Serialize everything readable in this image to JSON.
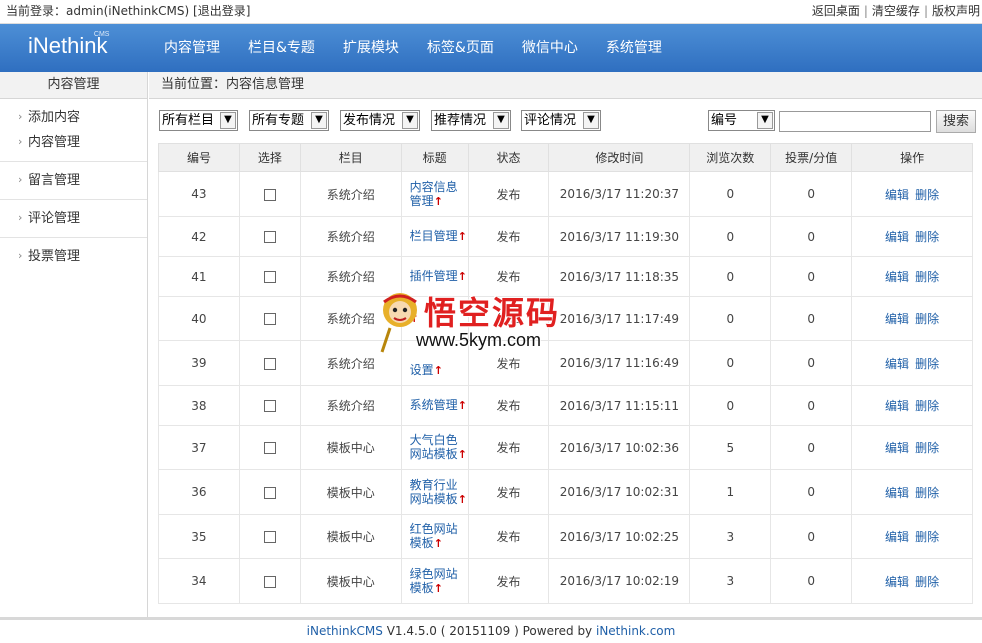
{
  "topbar": {
    "login_text": "当前登录：admin(iNethinkCMS)  [退出登录]",
    "links": [
      "返回桌面",
      "清空缓存",
      "版权声明"
    ]
  },
  "brand": {
    "name": "iNethink",
    "badge": "CMS"
  },
  "nav": [
    "内容管理",
    "栏目&专题",
    "扩展模块",
    "标签&页面",
    "微信中心",
    "系统管理"
  ],
  "sidebar": {
    "title": "内容管理",
    "groups": [
      [
        "添加内容",
        "内容管理"
      ],
      [
        "留言管理"
      ],
      [
        "评论管理"
      ],
      [
        "投票管理"
      ]
    ]
  },
  "breadcrumb": "当前位置：内容信息管理",
  "filters": {
    "selects": [
      "所有栏目",
      "所有专题",
      "发布情况",
      "推荐情况",
      "评论情况"
    ],
    "search_field": "编号",
    "search_button": "搜索"
  },
  "table": {
    "headers": [
      "编号",
      "选择",
      "栏目",
      "标题",
      "状态",
      "修改时间",
      "浏览次数",
      "投票/分值",
      "操作"
    ],
    "rows": [
      {
        "id": "43",
        "column": "系统介绍",
        "title": [
          "内容信息",
          "管理"
        ],
        "status": "发布",
        "time": "2016/3/17 11:20:37",
        "views": "0",
        "votes": "0"
      },
      {
        "id": "42",
        "column": "系统介绍",
        "title": [
          "栏目管理"
        ],
        "status": "发布",
        "time": "2016/3/17 11:19:30",
        "views": "0",
        "votes": "0"
      },
      {
        "id": "41",
        "column": "系统介绍",
        "title": [
          "插件管理"
        ],
        "status": "发布",
        "time": "2016/3/17 11:18:35",
        "views": "0",
        "votes": "0"
      },
      {
        "id": "40",
        "column": "系统介绍",
        "title": [
          ""
        ],
        "status": "发布",
        "time": "2016/3/17 11:17:49",
        "views": "0",
        "votes": "0"
      },
      {
        "id": "39",
        "column": "系统介绍",
        "title": [
          "",
          "设置"
        ],
        "status": "发布",
        "time": "2016/3/17 11:16:49",
        "views": "0",
        "votes": "0"
      },
      {
        "id": "38",
        "column": "系统介绍",
        "title": [
          "系统管理"
        ],
        "status": "发布",
        "time": "2016/3/17 11:15:11",
        "views": "0",
        "votes": "0"
      },
      {
        "id": "37",
        "column": "模板中心",
        "title": [
          "大气白色",
          "网站模板"
        ],
        "status": "发布",
        "time": "2016/3/17 10:02:36",
        "views": "5",
        "votes": "0"
      },
      {
        "id": "36",
        "column": "模板中心",
        "title": [
          "教育行业",
          "网站模板"
        ],
        "status": "发布",
        "time": "2016/3/17 10:02:31",
        "views": "1",
        "votes": "0"
      },
      {
        "id": "35",
        "column": "模板中心",
        "title": [
          "红色网站",
          "模板"
        ],
        "status": "发布",
        "time": "2016/3/17 10:02:25",
        "views": "3",
        "votes": "0"
      },
      {
        "id": "34",
        "column": "模板中心",
        "title": [
          "绿色网站",
          "模板"
        ],
        "status": "发布",
        "time": "2016/3/17 10:02:19",
        "views": "3",
        "votes": "0"
      }
    ],
    "edit_label": "编辑",
    "delete_label": "删除"
  },
  "footer": {
    "product": "iNethinkCMS",
    "version": " V1.4.5.0 ( 20151109 )   Powered by ",
    "powered": "iNethink.com"
  },
  "watermark": {
    "brand": "悟空源码",
    "url": "www.5kym.com"
  },
  "colors": {
    "nav_bg": "#3a7cc9",
    "link": "#2060a8",
    "up_arrow": "#c00000"
  }
}
